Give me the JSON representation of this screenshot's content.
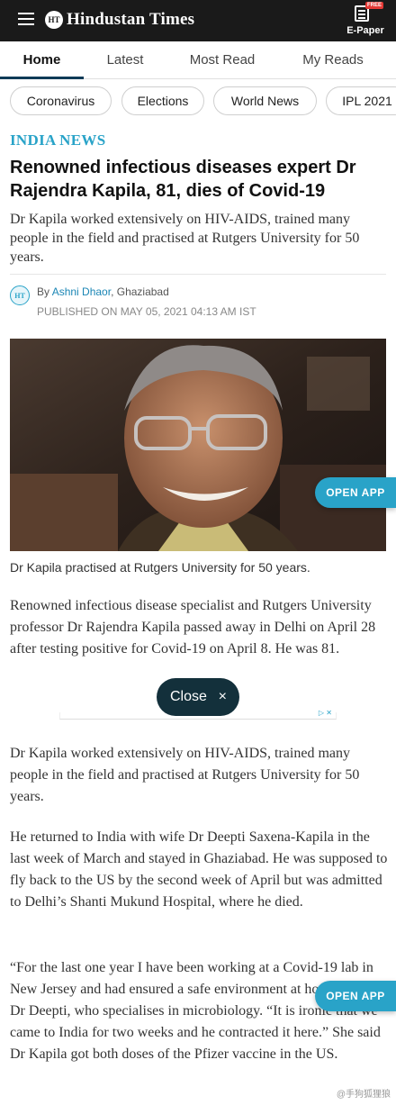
{
  "header": {
    "logo_mark": "HT",
    "logo_text": "Hindustan Times",
    "epaper_badge": "FREE",
    "epaper_label": "E-Paper"
  },
  "tabs": [
    {
      "label": "Home",
      "active": true
    },
    {
      "label": "Latest",
      "active": false
    },
    {
      "label": "Most Read",
      "active": false
    },
    {
      "label": "My Reads",
      "active": false
    }
  ],
  "chips": [
    "Coronavirus",
    "Elections",
    "World News",
    "IPL 2021"
  ],
  "article": {
    "section": "INDIA NEWS",
    "headline": "Renowned infectious diseases expert Dr Rajendra Kapila, 81, dies of Covid-19",
    "summary": "Dr Kapila worked extensively on HIV-AIDS, trained many people in the field and practised at Rutgers University for 50 years.",
    "byline_prefix": "By",
    "author": "Ashni Dhaor",
    "location": ", Ghaziabad",
    "published": "PUBLISHED ON MAY 05, 2021 04:13 AM IST",
    "caption": "Dr Kapila practised at Rutgers University for 50 years.",
    "paragraphs": [
      "Renowned infectious disease specialist and Rutgers University professor Dr Rajendra Kapila passed away in Delhi on April 28 after testing positive for Covid-19 on April 8. He was 81.",
      "Dr Kapila worked extensively on HIV-AIDS, trained many people in the field and practised at Rutgers University for 50 years.",
      "He returned to India with wife Dr Deepti Saxena-Kapila in the last week of March and stayed in Ghaziabad. He was supposed to fly back to the US by the second week of April but was admitted to Delhi’s Shanti Mukund Hospital, where he died.",
      "“For the last one year I have been working at a Covid-19 lab in New Jersey and had ensured a safe environment at home,” said Dr Deepti, who specialises in microbiology. “It is ironic that we came to India for two weeks and he contracted it here.” She said Dr Kapila got both doses of the Pfizer vaccine in the US."
    ]
  },
  "overlays": {
    "open_app": "OPEN APP",
    "close_label": "Close",
    "close_icon": "×",
    "ad_mark": "▷ ✕"
  },
  "watermark": "@手狗狐狸狼"
}
